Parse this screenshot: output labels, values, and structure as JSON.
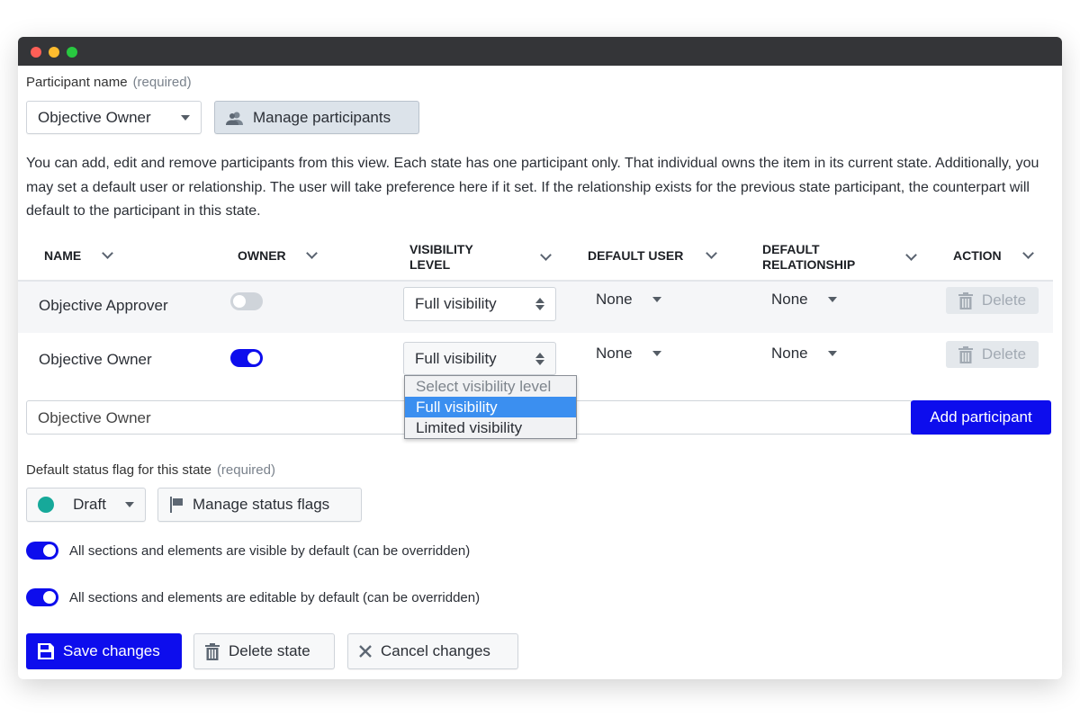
{
  "window": {
    "controls": [
      "close",
      "minimize",
      "maximize"
    ]
  },
  "participant": {
    "label": "Participant name",
    "required": "(required)",
    "selected": "Objective Owner",
    "manage_label": "Manage participants"
  },
  "description": "You can add, edit and remove participants from this view. Each state has one participant only. That individual owns the item in its current state. Additionally, you may set a default user or relationship. The user will take preference here if it set. If the relationship exists for the previous state participant, the counterpart will default to the participant in this state.",
  "table": {
    "headers": {
      "name": "NAME",
      "owner": "OWNER",
      "visibility": "VISIBILITY LEVEL",
      "default_user": "DEFAULT USER",
      "default_relationship": "DEFAULT RELATIONSHIP",
      "action": "ACTION"
    },
    "rows": [
      {
        "name": "Objective Approver",
        "owner": false,
        "visibility": "Full visibility",
        "default_user": "None",
        "default_relationship": "None",
        "action": "Delete"
      },
      {
        "name": "Objective Owner",
        "owner": true,
        "visibility": "Full visibility",
        "default_user": "None",
        "default_relationship": "None",
        "action": "Delete"
      }
    ]
  },
  "visibility_dropdown": {
    "options": [
      "Select visibility level",
      "Full visibility",
      "Limited visibility"
    ],
    "highlighted": "Full visibility"
  },
  "add_row": {
    "input_value": "Objective Owner",
    "button": "Add participant"
  },
  "status_flag": {
    "label": "Default status flag for this state",
    "required": "(required)",
    "selected": "Draft",
    "selected_color": "#16a99a",
    "manage_label": "Manage status flags"
  },
  "toggles": [
    {
      "label": "All sections and elements are visible by default (can be overridden)",
      "on": true
    },
    {
      "label": "All sections and elements are editable by default (can be overridden)",
      "on": true
    }
  ],
  "actions": {
    "save": "Save changes",
    "delete": "Delete state",
    "cancel": "Cancel changes"
  },
  "colors": {
    "primary": "#0d0ded",
    "titlebar": "#343538",
    "highlight": "#3b8ff0"
  }
}
